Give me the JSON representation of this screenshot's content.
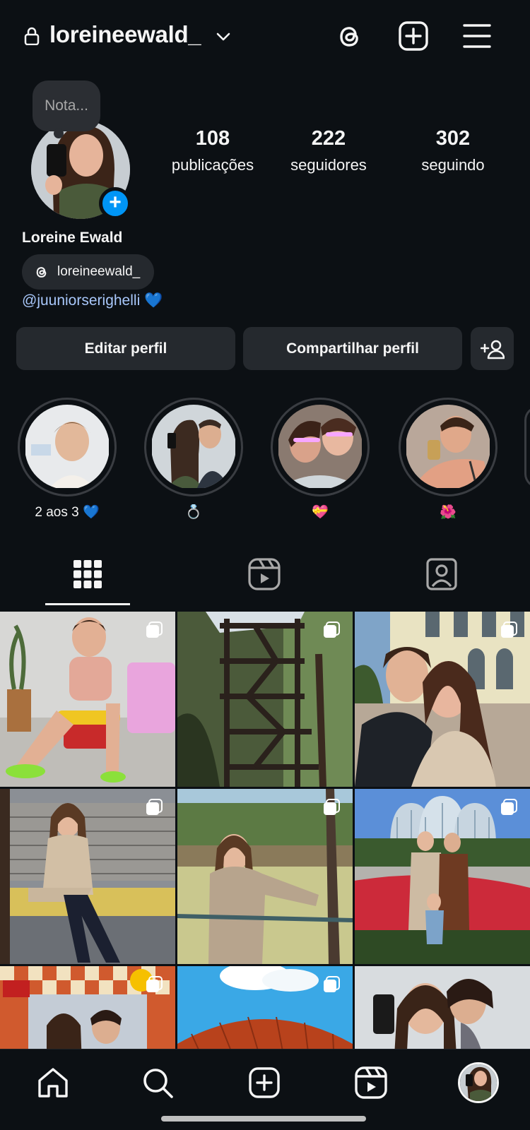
{
  "header": {
    "username": "loreineewald_",
    "icons": [
      "lock-icon",
      "chevron-down-icon",
      "threads-icon",
      "new-post-icon",
      "menu-icon"
    ]
  },
  "note": {
    "placeholder": "Nota..."
  },
  "stats": [
    {
      "num": "108",
      "label": "publicações"
    },
    {
      "num": "222",
      "label": "seguidores"
    },
    {
      "num": "302",
      "label": "seguindo"
    }
  ],
  "profile": {
    "display_name": "Loreine Ewald",
    "threads_handle": "loreineewald_",
    "bio_mention": "@juuniorserighelli",
    "bio_emoji": "💙"
  },
  "buttons": {
    "edit": "Editar perfil",
    "share": "Compartilhar perfil"
  },
  "highlights": [
    {
      "label": "2 aos 3 💙"
    },
    {
      "label": "💍"
    },
    {
      "label": "💝"
    },
    {
      "label": "🌺"
    }
  ],
  "tabs": [
    "posts-grid-icon",
    "reels-icon",
    "tagged-icon"
  ],
  "bottom_nav": [
    "home-icon",
    "search-icon",
    "create-icon",
    "reels-icon",
    "profile-avatar"
  ],
  "colors": {
    "background": "#0c1014",
    "accent": "#0095f6",
    "button": "#25292e",
    "mention": "#a8c7fa"
  }
}
